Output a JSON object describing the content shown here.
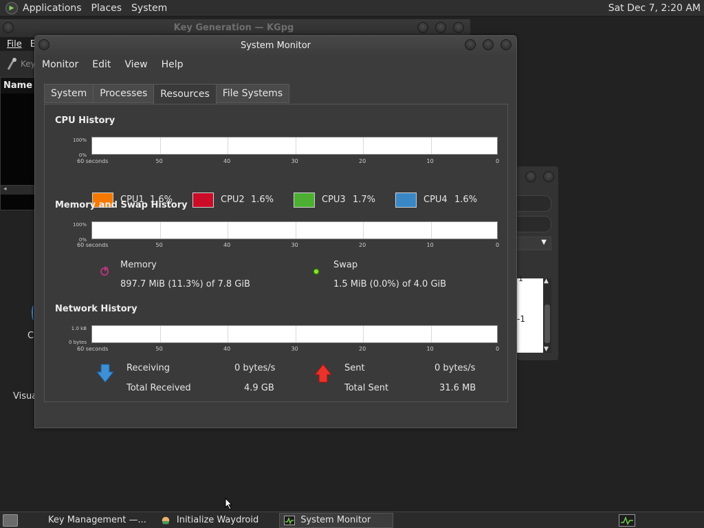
{
  "top_panel": {
    "applications": "Applications",
    "places": "Places",
    "system": "System",
    "clock": "Sat Dec 7,  2:20 AM"
  },
  "kgpg": {
    "title": "Key Generation — KGpg",
    "menu_file": "File",
    "menu_edit": "E",
    "toolbar_fragment": "Key",
    "list_header": "Name"
  },
  "desktop": {
    "label_c": "C",
    "label_visual": "Visua"
  },
  "side_dialog": {
    "list_frag_1": "1",
    "list_frag_2": "-1"
  },
  "sysmon": {
    "title": "System Monitor",
    "menus": [
      "Monitor",
      "Edit",
      "View",
      "Help"
    ],
    "tabs": [
      "System",
      "Processes",
      "Resources",
      "File Systems"
    ],
    "active_tab": "Resources",
    "cpu": {
      "title": "CPU History",
      "y_top": "100%",
      "y_bottom": "0%",
      "x_labels": [
        "60 seconds",
        "50",
        "40",
        "30",
        "20",
        "10",
        "0"
      ],
      "cores": [
        {
          "name": "CPU1",
          "value": "1.6%",
          "color": "#f57900"
        },
        {
          "name": "CPU2",
          "value": "1.6%",
          "color": "#cc0b26"
        },
        {
          "name": "CPU3",
          "value": "1.7%",
          "color": "#4caf32"
        },
        {
          "name": "CPU4",
          "value": "1.6%",
          "color": "#3a87c6"
        }
      ]
    },
    "mem": {
      "title": "Memory and Swap History",
      "y_top": "100%",
      "y_bottom": "0%",
      "x_labels": [
        "60 seconds",
        "50",
        "40",
        "30",
        "20",
        "10",
        "0"
      ],
      "memory_label": "Memory",
      "memory_value": "897.7 MiB (11.3%) of 7.8 GiB",
      "memory_color": "#b5367a",
      "swap_label": "Swap",
      "swap_value": "1.5 MiB (0.0%) of 4.0 GiB",
      "swap_color": "#4e9a06"
    },
    "net": {
      "title": "Network History",
      "y_top": "1.0 kB",
      "y_bottom": "0 bytes",
      "x_labels": [
        "60 seconds",
        "50",
        "40",
        "30",
        "20",
        "10",
        "0"
      ],
      "receiving_label": "Receiving",
      "receiving_value": "0 bytes/s",
      "total_received_label": "Total Received",
      "total_received_value": "4.9 GB",
      "sent_label": "Sent",
      "sent_value": "0 bytes/s",
      "total_sent_label": "Total Sent",
      "total_sent_value": "31.6 MB"
    }
  },
  "taskbar": {
    "items": [
      "Key Management —...",
      "Initialize Waydroid",
      "System Monitor"
    ]
  }
}
